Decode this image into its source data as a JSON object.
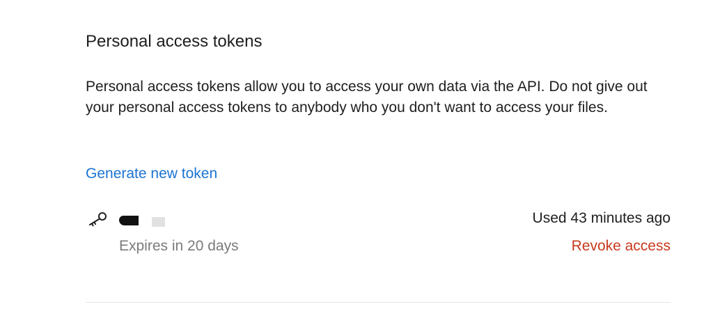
{
  "section": {
    "title": "Personal access tokens",
    "description": "Personal access tokens allow you to access your own data via the API. Do not give out your personal access tokens to anybody who you don't want to access your files.",
    "generate_label": "Generate new token"
  },
  "tokens": [
    {
      "icon": "key-icon",
      "name": "",
      "name_redacted": true,
      "expires": "Expires in 20 days",
      "last_used": "Used 43 minutes ago",
      "revoke_label": "Revoke access"
    }
  ],
  "colors": {
    "text": "#1e1e1e",
    "muted": "#7a7a7a",
    "link": "#1b73d1",
    "danger": "#c8391d",
    "divider": "#e4e4e4"
  }
}
